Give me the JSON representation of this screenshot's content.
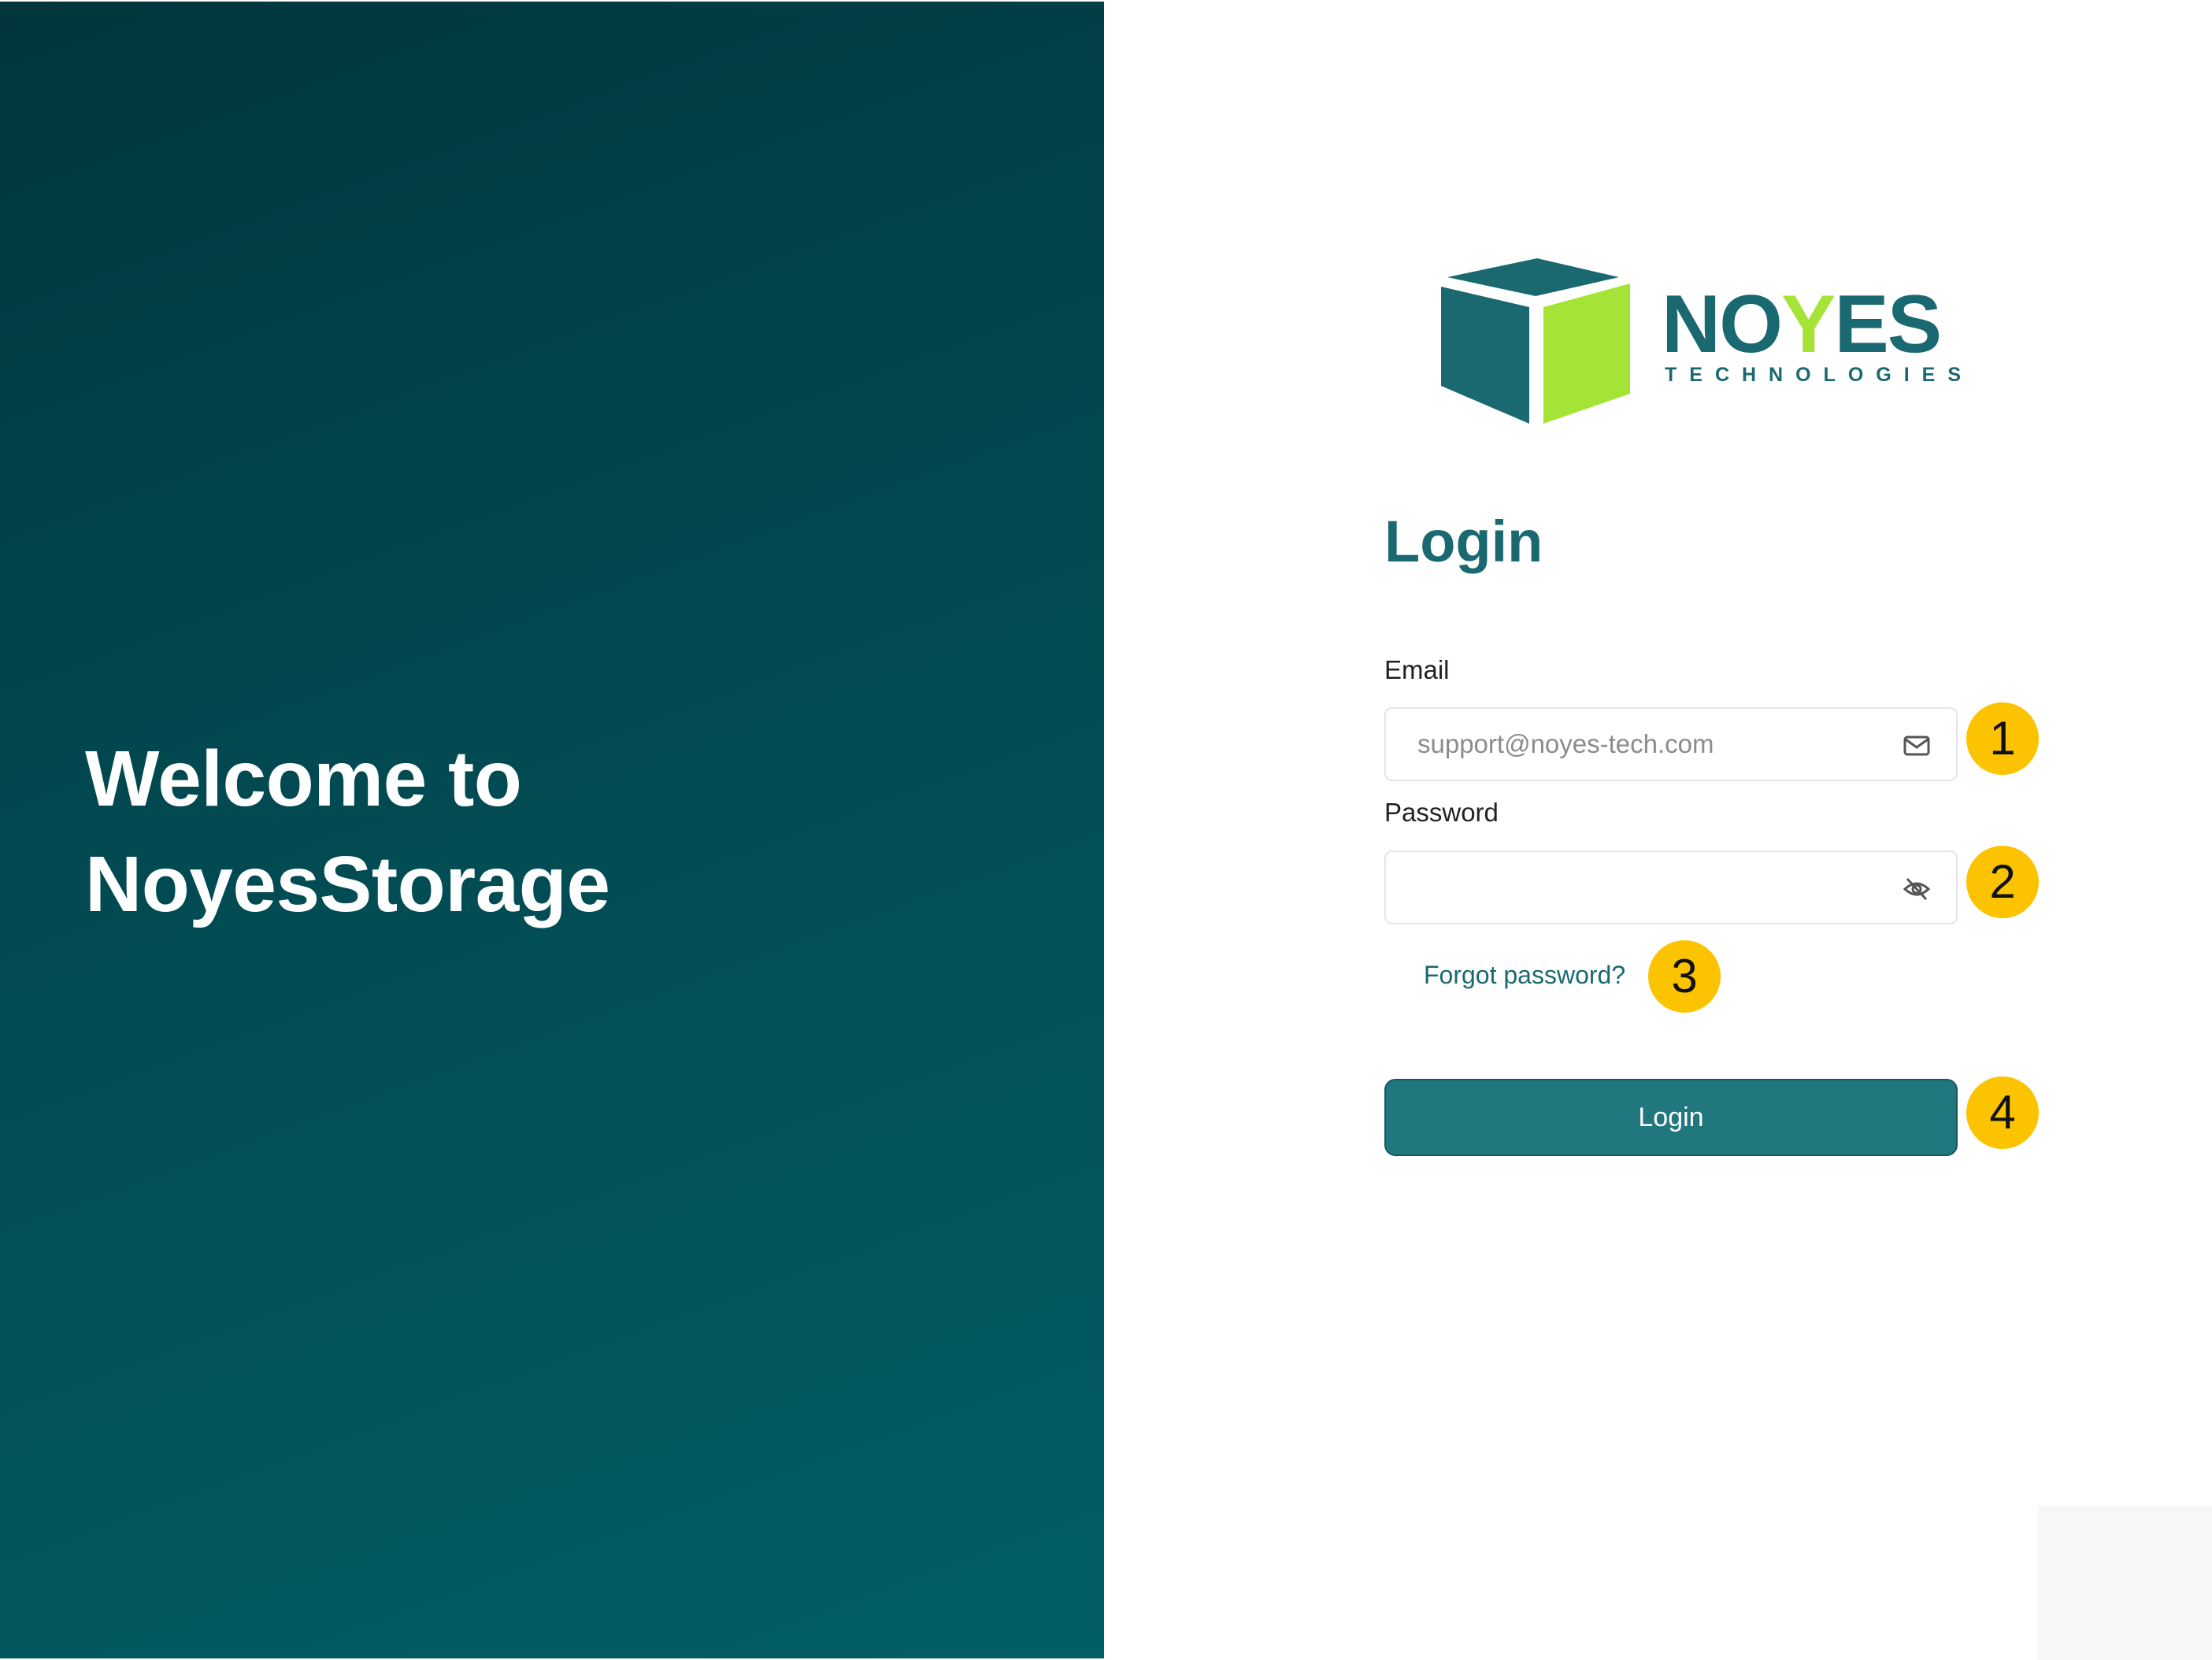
{
  "hero": {
    "title_line1": "Welcome to",
    "title_line2": "NoyesStorage"
  },
  "logo": {
    "word_left": "NO",
    "word_accent": "Y",
    "word_right": "ES",
    "subtitle": "TECHNOLOGIES",
    "icon": "cube-logo-icon"
  },
  "form": {
    "title": "Login",
    "email": {
      "label": "Email",
      "placeholder": "support@noyes-tech.com",
      "icon": "mail-icon"
    },
    "password": {
      "label": "Password",
      "value": "",
      "icon": "eye-off-icon"
    },
    "forgot_label": "Forgot password?",
    "submit_label": "Login"
  },
  "markers": [
    "1",
    "2",
    "3",
    "4"
  ],
  "colors": {
    "hero_dark": "#02353c",
    "hero_light": "#025e66",
    "brand_teal": "#1a6970",
    "brand_green": "#a5e436",
    "button": "#20787e",
    "marker": "#fcc300"
  }
}
